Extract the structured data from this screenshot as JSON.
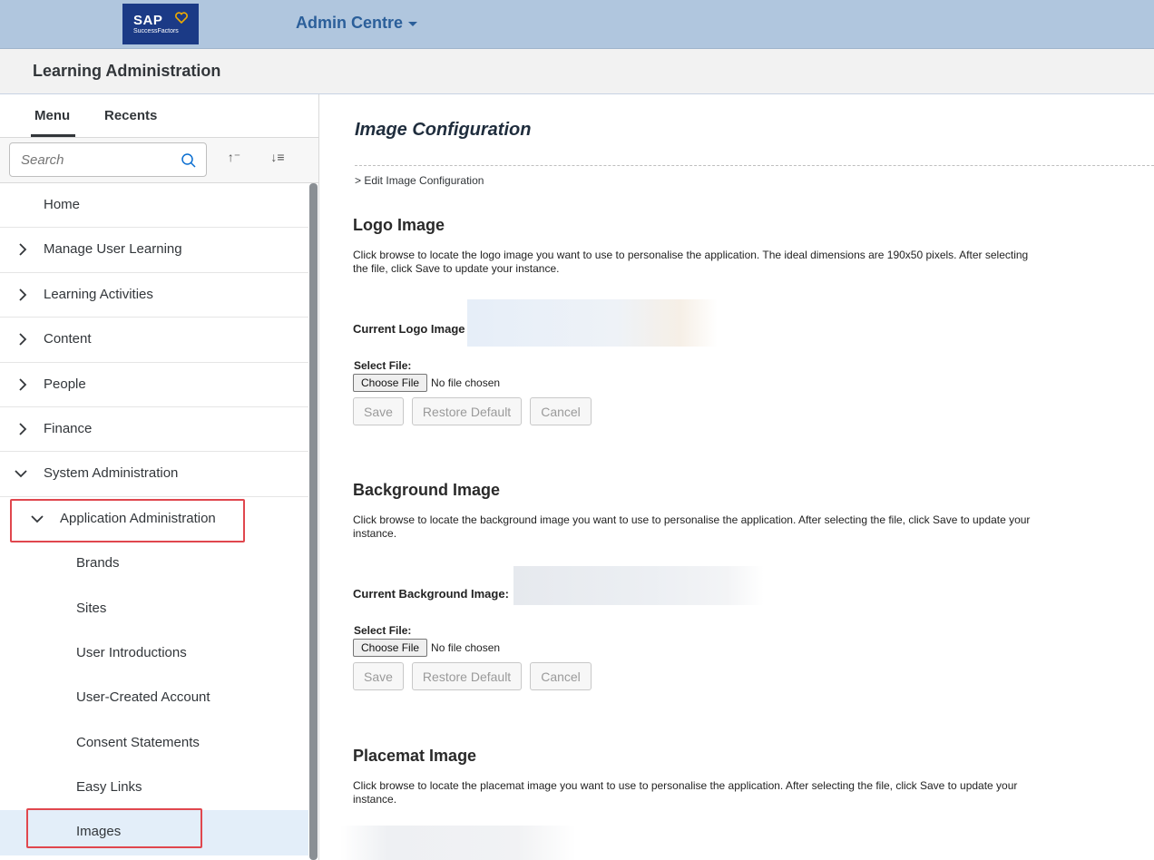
{
  "shell": {
    "logo": {
      "brand": "SAP",
      "product": "SuccessFactors"
    },
    "title": "Admin Centre"
  },
  "page_header": {
    "title": "Learning Administration"
  },
  "sidebar": {
    "tabs": [
      {
        "label": "Menu"
      },
      {
        "label": "Recents"
      }
    ],
    "search": {
      "placeholder": "Search"
    },
    "items": [
      {
        "label": "Home"
      },
      {
        "label": "Manage User Learning"
      },
      {
        "label": "Learning Activities"
      },
      {
        "label": "Content"
      },
      {
        "label": "People"
      },
      {
        "label": "Finance"
      },
      {
        "label": "System Administration"
      },
      {
        "label": "Application Administration"
      },
      {
        "label": "Brands"
      },
      {
        "label": "Sites"
      },
      {
        "label": "User Introductions"
      },
      {
        "label": "User-Created Account"
      },
      {
        "label": "Consent Statements"
      },
      {
        "label": "Easy Links"
      },
      {
        "label": "Images"
      }
    ]
  },
  "main": {
    "title": "Image Configuration",
    "breadcrumb": "> Edit Image Configuration",
    "sections": [
      {
        "heading": "Logo Image",
        "description": "Click browse to locate the logo image you want to use to personalise the application. The ideal dimensions are 190x50 pixels. After selecting the file, click Save to update your instance.",
        "current_label": "Current Logo Image",
        "select_label": "Select File:",
        "choose_label": "Choose File",
        "no_file": "No file chosen",
        "buttons": {
          "save": "Save",
          "restore": "Restore Default",
          "cancel": "Cancel"
        }
      },
      {
        "heading": "Background Image",
        "description": "Click browse to locate the background image you want to use to personalise the application. After selecting the file, click Save to update your instance.",
        "current_label": "Current Background Image:",
        "select_label": "Select File:",
        "choose_label": "Choose File",
        "no_file": "No file chosen",
        "buttons": {
          "save": "Save",
          "restore": "Restore Default",
          "cancel": "Cancel"
        }
      },
      {
        "heading": "Placemat Image",
        "description": "Click browse to locate the placemat image you want to use to personalise the application. After selecting the file, click Save to update your instance."
      }
    ]
  },
  "colors": {
    "shell_bg": "#b0c6de",
    "highlight": "#e0474e",
    "selected_bg": "#e3eef9"
  }
}
